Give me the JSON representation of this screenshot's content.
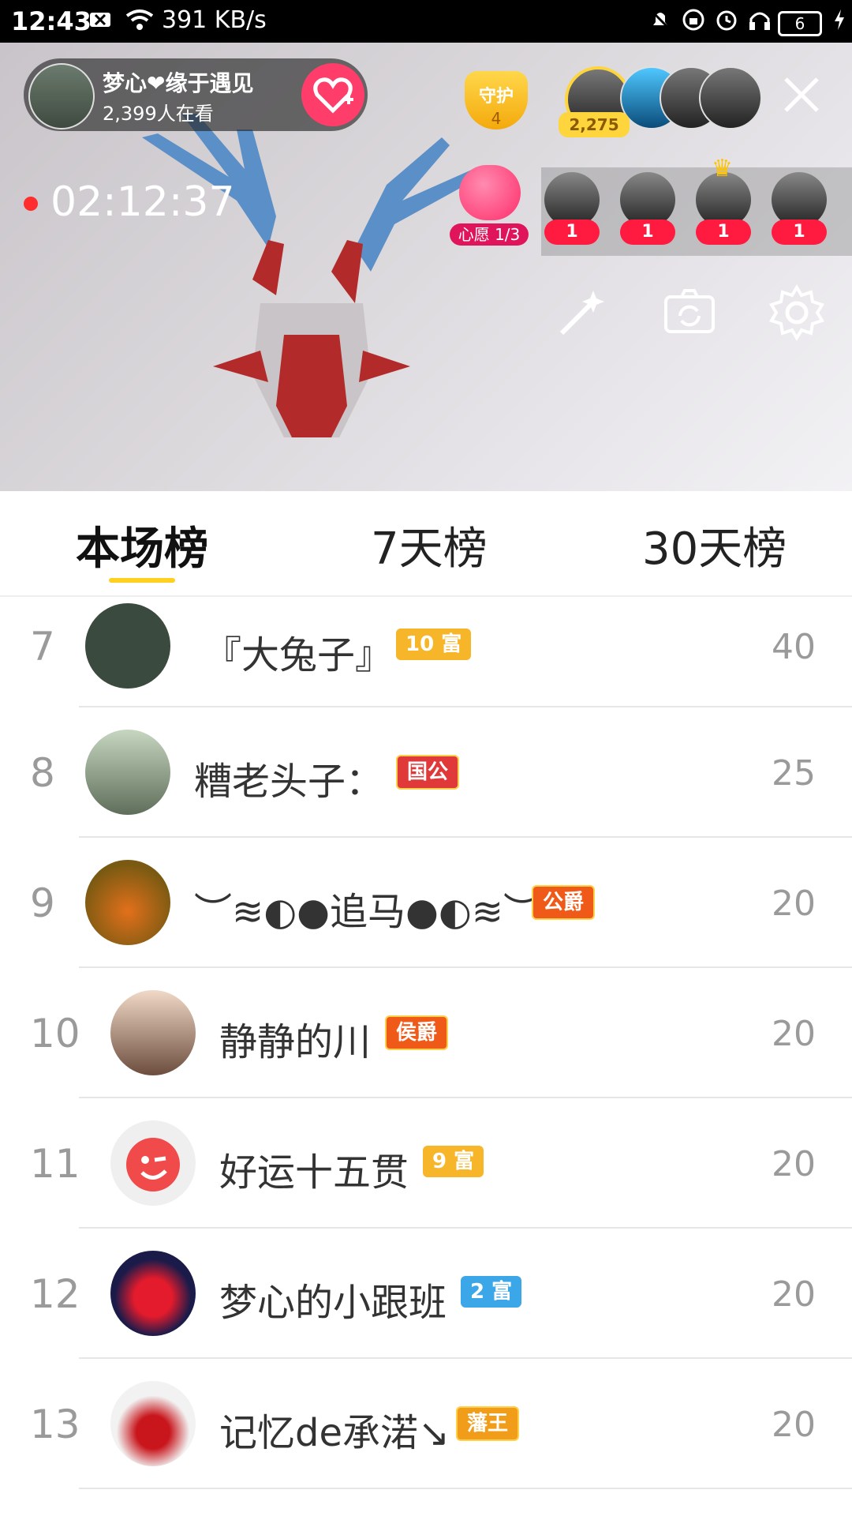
{
  "status_bar": {
    "time": "12:43",
    "net_speed": "391 KB/s",
    "battery": "6"
  },
  "live": {
    "host_name": "梦心❤缘于遇见",
    "viewers": "2,399人在看",
    "guard_label": "守护",
    "guard_count": "4",
    "top_viewer_gold": "2,275",
    "rec_time": "02:12:37",
    "wish_label": "心愿 1/3",
    "gift_counts": [
      "1",
      "1",
      "1",
      "1"
    ]
  },
  "tabs": {
    "items": [
      {
        "label": "本场榜"
      },
      {
        "label": "7天榜"
      },
      {
        "label": "30天榜"
      }
    ]
  },
  "rows": [
    {
      "rank": "7",
      "name": "『大兔子』",
      "badge": "10 富",
      "score": "40"
    },
    {
      "rank": "8",
      "name": "糟老头子：",
      "badge": "国公",
      "score": "25"
    },
    {
      "rank": "9",
      "name": "︶≋◐●追马●◐≋︶",
      "badge": "公爵",
      "score": "20"
    },
    {
      "rank": "10",
      "name": "静静的川",
      "badge": "侯爵",
      "score": "20"
    },
    {
      "rank": "11",
      "name": "好运十五贯",
      "badge": "9 富",
      "score": "20"
    },
    {
      "rank": "12",
      "name": "梦心的小跟班",
      "badge": "2 富",
      "score": "20"
    },
    {
      "rank": "13",
      "name": "记忆de承渃↘",
      "badge": "藩王",
      "score": "20"
    }
  ]
}
